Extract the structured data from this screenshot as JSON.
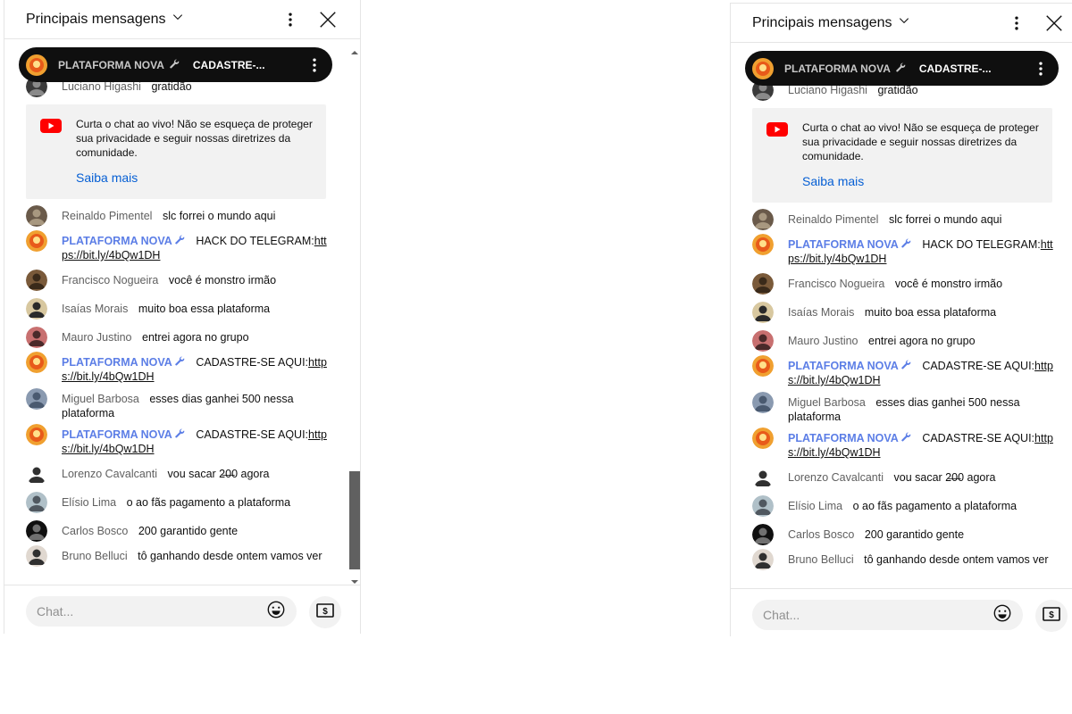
{
  "header": {
    "title": "Principais mensagens"
  },
  "pinned": {
    "author": "PLATAFORMA NOVA",
    "message": "CADASTRE-..."
  },
  "notice": {
    "text": "Curta o chat ao vivo! Não se esqueça de proteger sua privacidade e seguir nossas diretrizes da comunidade.",
    "link": "Saiba mais"
  },
  "messages": [
    {
      "author": "Luciano Higashi",
      "text": "gratidão",
      "owner": false,
      "link": ""
    },
    {
      "author": "Reinaldo Pimentel",
      "text": "slc forrei o mundo aqui",
      "owner": false,
      "link": ""
    },
    {
      "author": "PLATAFORMA NOVA",
      "text": "HACK DO TELEGRAM:",
      "owner": true,
      "link": "https://bit.ly/4bQw1DH"
    },
    {
      "author": "Francisco Nogueira",
      "text": "você é monstro irmão",
      "owner": false,
      "link": ""
    },
    {
      "author": "Isaías Morais",
      "text": "muito boa essa plataforma",
      "owner": false,
      "link": ""
    },
    {
      "author": "Mauro Justino",
      "text": "entrei agora no grupo",
      "owner": false,
      "link": ""
    },
    {
      "author": "PLATAFORMA NOVA",
      "text": "CADASTRE-SE AQUI:",
      "owner": true,
      "link": "https://bit.ly/4bQw1DH"
    },
    {
      "author": "Miguel Barbosa",
      "text": "esses dias ganhei 500 nessa plataforma",
      "owner": false,
      "link": ""
    },
    {
      "author": "PLATAFORMA NOVA",
      "text": "CADASTRE-SE AQUI:",
      "owner": true,
      "link": "https://bit.ly/4bQw1DH"
    },
    {
      "author": "Lorenzo Cavalcanti",
      "text": "vou sacar 2̶0̶0 agora",
      "owner": false,
      "link": ""
    },
    {
      "author": "Elísio Lima",
      "text": "o ao fãs pagamento a plataforma",
      "owner": false,
      "link": ""
    },
    {
      "author": "Carlos Bosco",
      "text": "200 garantido gente",
      "owner": false,
      "link": ""
    },
    {
      "author": "Bruno Belluci",
      "text": "tô ganhando desde ontem vamos ver",
      "owner": false,
      "link": ""
    }
  ],
  "input": {
    "placeholder": "Chat..."
  },
  "colors": {
    "owner": "#5c7ee6",
    "pinned_bg": "#0f0f0f",
    "link": "#065fd4",
    "yt_red": "#ff0000"
  }
}
